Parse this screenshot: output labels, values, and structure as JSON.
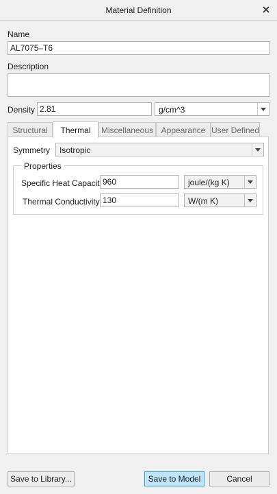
{
  "window": {
    "title": "Material Definition",
    "close_icon": "close-icon"
  },
  "name": {
    "label": "Name",
    "value": "AL7075–T6"
  },
  "description": {
    "label": "Description",
    "value": ""
  },
  "density": {
    "label": "Density",
    "value": "2.81",
    "unit": "g/cm^3"
  },
  "tabs": [
    {
      "label": "Structural"
    },
    {
      "label": "Thermal"
    },
    {
      "label": "Miscellaneous"
    },
    {
      "label": "Appearance"
    },
    {
      "label": "User Defined"
    }
  ],
  "active_tab": "Thermal",
  "symmetry": {
    "label": "Symmetry",
    "value": "Isotropic"
  },
  "properties": {
    "legend": "Properties",
    "rows": [
      {
        "label": "Specific Heat Capacity",
        "value": "960",
        "unit": "joule/(kg K)"
      },
      {
        "label": "Thermal Conductivity",
        "value": "130",
        "unit": "W/(m K)"
      }
    ]
  },
  "footer": {
    "save_library": "Save to Library...",
    "save_model": "Save to Model",
    "cancel": "Cancel"
  },
  "colors": {
    "primary_button": "#bfe3f7",
    "primary_border": "#3c9fdd",
    "panel": "#ffffff",
    "chrome": "#f0f0f0"
  }
}
